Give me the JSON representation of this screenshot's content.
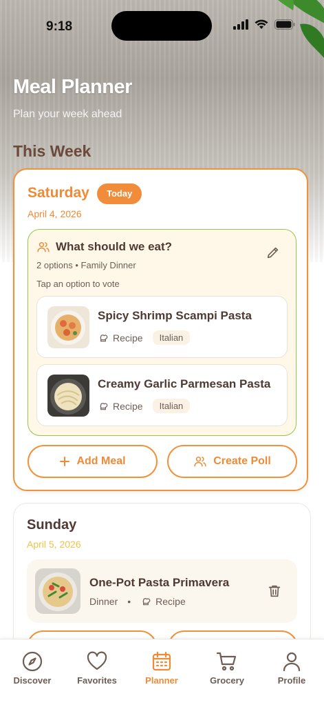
{
  "status": {
    "time": "9:18"
  },
  "header": {
    "title": "Meal Planner",
    "subtitle": "Plan your week ahead"
  },
  "section_title": "This Week",
  "saturday": {
    "day": "Saturday",
    "badge": "Today",
    "date": "April 4, 2026",
    "poll": {
      "title": "What should we eat?",
      "meta": "2 options • Family Dinner",
      "hint": "Tap an option to vote",
      "options": [
        {
          "name": "Spicy Shrimp Scampi Pasta",
          "type": "Recipe",
          "tag": "Italian"
        },
        {
          "name": "Creamy Garlic Parmesan Pasta",
          "type": "Recipe",
          "tag": "Italian"
        }
      ]
    },
    "add_meal_label": "Add Meal",
    "create_poll_label": "Create Poll"
  },
  "sunday": {
    "day": "Sunday",
    "date": "April 5, 2026",
    "meal": {
      "name": "One-Pot Pasta Primavera",
      "meal_type": "Dinner",
      "separator": "•",
      "type": "Recipe"
    }
  },
  "tabs": [
    {
      "label": "Discover",
      "icon": "compass-icon"
    },
    {
      "label": "Favorites",
      "icon": "heart-icon"
    },
    {
      "label": "Planner",
      "icon": "calendar-icon",
      "active": true
    },
    {
      "label": "Grocery",
      "icon": "cart-icon"
    },
    {
      "label": "Profile",
      "icon": "person-icon"
    }
  ],
  "colors": {
    "accent": "#ef8a36",
    "poll_border": "#8fc94a",
    "sunday_date": "#f2c249",
    "text_dark": "#4e3a33"
  }
}
